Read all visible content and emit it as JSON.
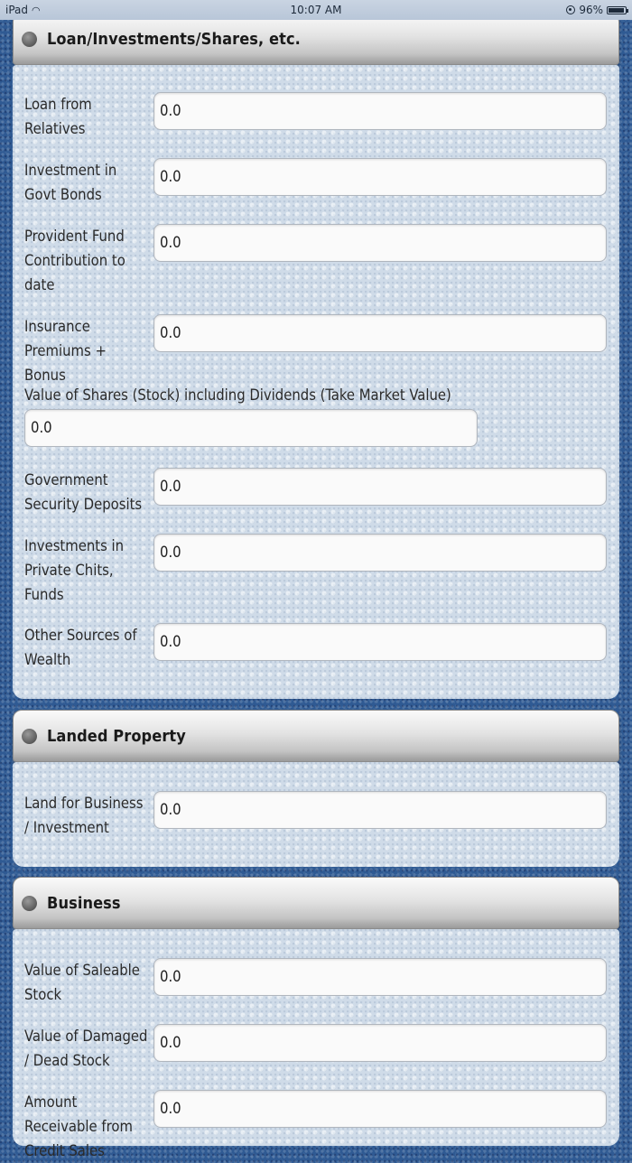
{
  "status_bar": {
    "device": "iPad",
    "time": "10:07 AM",
    "battery": "96%",
    "battery_level": 0.96
  },
  "sections": [
    {
      "title": "Loan/Investments/Shares, etc.",
      "fields": [
        {
          "label": "Loan from Relatives",
          "value": "0.0"
        },
        {
          "label": "Investment in Govt Bonds",
          "value": "0.0"
        },
        {
          "label": "Provident Fund Contribution to date",
          "value": "0.0"
        },
        {
          "label": "Insurance Premiums + Bonus",
          "value": "0.0"
        },
        {
          "label": "Value of Shares (Stock) including Dividends (Take Market Value)",
          "value": "0.0"
        },
        {
          "label": "Government Security Deposits",
          "value": "0.0"
        },
        {
          "label": "Investments in Private Chits, Funds",
          "value": "0.0"
        },
        {
          "label": "Other Sources of Wealth",
          "value": "0.0"
        }
      ]
    },
    {
      "title": "Landed Property",
      "fields": [
        {
          "label": "Land for Business / Investment",
          "value": "0.0"
        }
      ]
    },
    {
      "title": "Business",
      "fields": [
        {
          "label": "Value of Saleable Stock",
          "value": "0.0"
        },
        {
          "label": "Value of Damaged / Dead Stock",
          "value": "0.0"
        },
        {
          "label": "Amount Receivable from Credit Sales",
          "value": "0.0"
        }
      ]
    }
  ]
}
